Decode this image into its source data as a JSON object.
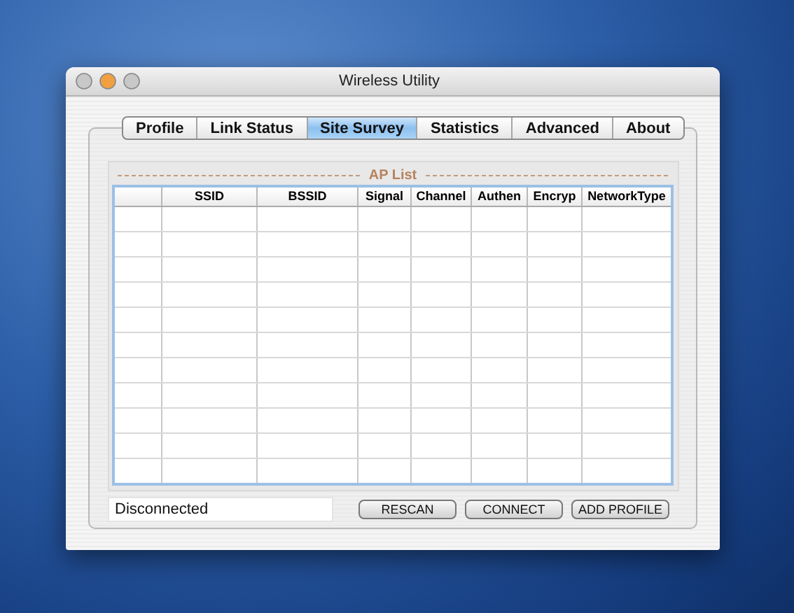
{
  "window": {
    "title": "Wireless Utility"
  },
  "tabs": [
    {
      "label": "Profile",
      "selected": false
    },
    {
      "label": "Link Status",
      "selected": false
    },
    {
      "label": "Site Survey",
      "selected": true
    },
    {
      "label": "Statistics",
      "selected": false
    },
    {
      "label": "Advanced",
      "selected": false
    },
    {
      "label": "About",
      "selected": false
    }
  ],
  "ap_list": {
    "title": "AP List",
    "columns": [
      "",
      "SSID",
      "BSSID",
      "Signal",
      "Channel",
      "Authen",
      "Encryp",
      "NetworkType"
    ]
  },
  "status_field": {
    "value": "Disconnected"
  },
  "buttons": [
    "RESCAN",
    "CONNECT",
    "ADD PROFILE"
  ]
}
